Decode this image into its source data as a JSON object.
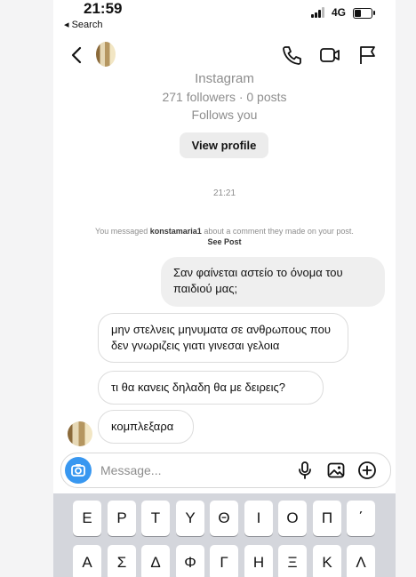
{
  "status_bar": {
    "time": "21:59",
    "back_label": "◂ Search",
    "network": "4G"
  },
  "header": {
    "icons": [
      "back-chevron-icon",
      "phone-icon",
      "video-camera-icon",
      "flag-icon"
    ]
  },
  "profile": {
    "name": "Instagram",
    "stats": "271 followers · 0 posts",
    "follow_status": "Follows you",
    "view_profile_label": "View profile"
  },
  "conversation": {
    "timestamp": "21:21",
    "notice_prefix": "You messaged",
    "notice_user": "konstamaria1",
    "notice_middle": "about a comment they made on your post.",
    "notice_link": "See Post",
    "messages": [
      {
        "direction": "outgoing",
        "text": "Σαν φαίνεται αστείο το όνομα του παιδιού μας;"
      },
      {
        "direction": "incoming",
        "text": "μην στελνεις μηνυματα σε ανθρωπους που δεν γνωριζεις  γιατι γινεσαι γελοια"
      },
      {
        "direction": "incoming",
        "text": "τι θα κανεις δηλαδη θα με δειρεις?"
      },
      {
        "direction": "incoming",
        "text": "κομπλεξαρα"
      }
    ]
  },
  "composer": {
    "placeholder": "Message...",
    "icons": [
      "camera-icon",
      "microphone-icon",
      "image-icon",
      "add-icon"
    ]
  },
  "keyboard": {
    "row1": [
      "Ε",
      "Ρ",
      "Τ",
      "Υ",
      "Θ",
      "Ι",
      "Ο",
      "Π",
      "΄"
    ],
    "row2": [
      "Α",
      "Σ",
      "Δ",
      "Φ",
      "Γ",
      "Η",
      "Ξ",
      "Κ",
      "Λ"
    ]
  },
  "colors": {
    "accent": "#3897f0",
    "outgoing_bubble": "#efefef",
    "muted_text": "#8d8d8d"
  }
}
